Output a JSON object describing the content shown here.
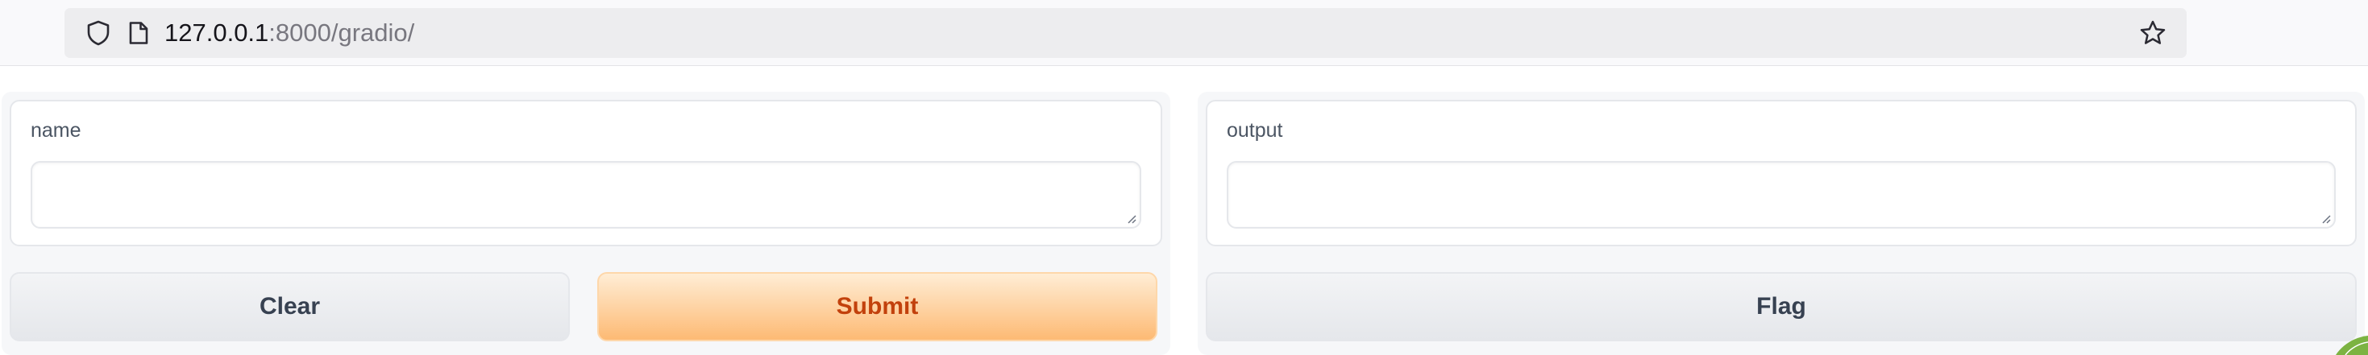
{
  "browser": {
    "url_host": "127.0.0.1",
    "url_rest": ":8000/gradio/",
    "icons": {
      "shield": "shield-icon",
      "page": "page-icon",
      "bookmark": "star-icon"
    }
  },
  "inputs": {
    "name_label": "name",
    "name_value": ""
  },
  "outputs": {
    "output_label": "output",
    "output_value": ""
  },
  "buttons": {
    "clear_label": "Clear",
    "submit_label": "Submit",
    "flag_label": "Flag"
  },
  "colors": {
    "primary_text": "#c2410c",
    "primary_bg_top": "#ffedd5",
    "primary_bg_bottom": "#fdba74",
    "secondary_text": "#374151",
    "panel_bg": "#f6f7f9"
  }
}
